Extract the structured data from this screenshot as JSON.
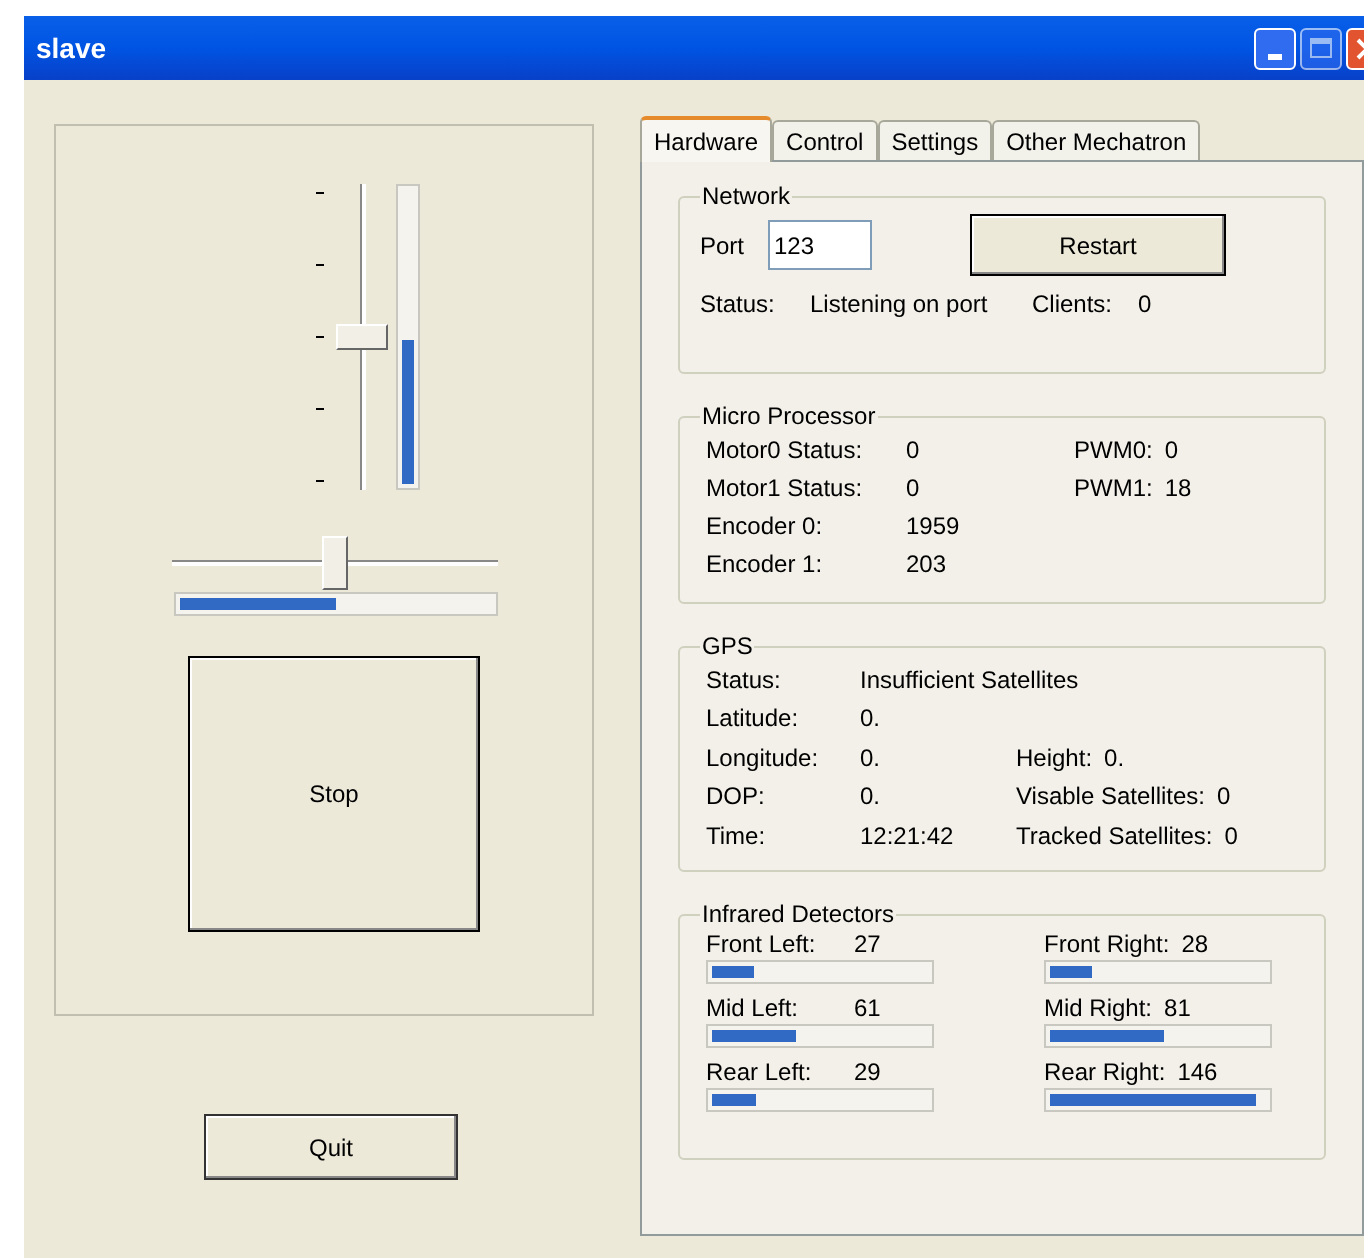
{
  "window": {
    "title": "slave"
  },
  "left": {
    "vertical_slider": {
      "level": 0.5
    },
    "vertical_progress": {
      "level": 0.49
    },
    "horizontal_slider": {
      "level": 0.5
    },
    "horizontal_progress": {
      "level": 0.5
    },
    "stop_button": "Stop",
    "quit_button": "Quit"
  },
  "tabs": [
    {
      "label": "Hardware",
      "selected": true
    },
    {
      "label": "Control",
      "selected": false
    },
    {
      "label": "Settings",
      "selected": false
    },
    {
      "label": "Other Mechatron",
      "selected": false
    }
  ],
  "network": {
    "title": "Network",
    "port_label": "Port",
    "port_value": "123",
    "restart_button": "Restart",
    "status_label": "Status:",
    "status_value": "Listening on port",
    "clients_label": "Clients:",
    "clients_value": "0"
  },
  "micro_processor": {
    "title": "Micro Processor",
    "rows": [
      {
        "label": "Motor0 Status:",
        "value": "0",
        "right": {
          "label": "PWM0:",
          "value": "0"
        }
      },
      {
        "label": "Motor1 Status:",
        "value": "0",
        "right": {
          "label": "PWM1:",
          "value": "18"
        }
      },
      {
        "label": "Encoder 0:",
        "value": "1959"
      },
      {
        "label": "Encoder 1:",
        "value": "203"
      }
    ]
  },
  "gps": {
    "title": "GPS",
    "rows": [
      {
        "label": "Status:",
        "value": "Insufficient Satellites"
      },
      {
        "label": "Latitude:",
        "value": "0."
      },
      {
        "label": "Longitude:",
        "value": "0.",
        "right": {
          "label": "Height:",
          "value": "0."
        }
      },
      {
        "label": "DOP:",
        "value": "0.",
        "right": {
          "label": "Visable Satellites:",
          "value": "0"
        }
      },
      {
        "label": "Time:",
        "value": "12:21:42",
        "right": {
          "label": "Tracked Satellites:",
          "value": "0"
        }
      }
    ]
  },
  "infrared": {
    "title": "Infrared Detectors",
    "detectors": [
      {
        "label": "Front Left:",
        "value": "27",
        "level": 0.19
      },
      {
        "label": "Front Right:",
        "value": "28",
        "level": 0.19
      },
      {
        "label": "Mid Left:",
        "value": "61",
        "level": 0.39
      },
      {
        "label": "Mid Right:",
        "value": "81",
        "level": 0.53
      },
      {
        "label": "Rear Left:",
        "value": "29",
        "level": 0.2
      },
      {
        "label": "Rear Right:",
        "value": "146",
        "level": 0.95
      }
    ]
  }
}
